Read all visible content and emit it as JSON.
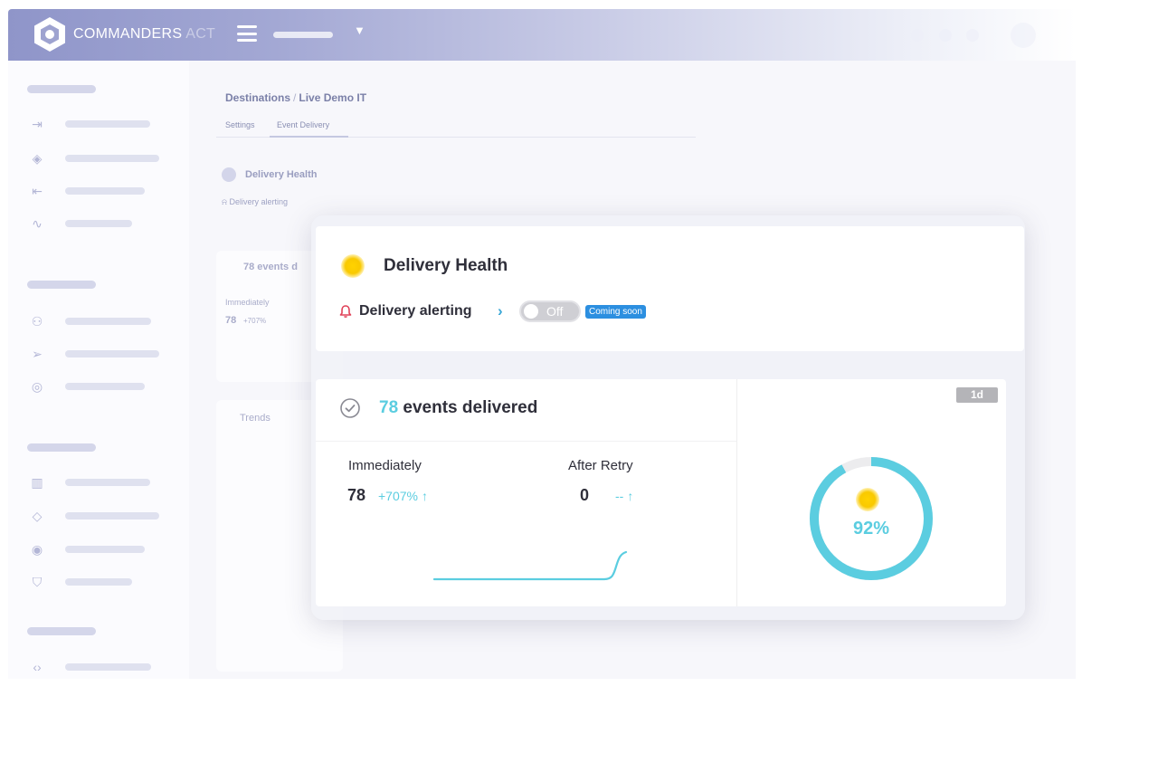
{
  "app": {
    "brand": "COMMANDERS",
    "brand_suffix": "ACT"
  },
  "breadcrumb": {
    "parent": "Destinations",
    "separator": "/",
    "current": "Live Demo IT"
  },
  "tabs": [
    {
      "label": "Settings",
      "active": false
    },
    {
      "label": "Event Delivery",
      "active": true
    }
  ],
  "background": {
    "delivery_health": "Delivery Health",
    "delivery_alerting": "Delivery alerting",
    "events": "78 events d",
    "immediately": "Immediately",
    "value": "78",
    "delta": "+707%",
    "trends": "Trends"
  },
  "health": {
    "title": "Delivery Health",
    "status_icon": "sun-icon",
    "alerting_label": "Delivery alerting",
    "toggle_label": "Off",
    "toggle_on": false,
    "coming_soon": "Coming soon"
  },
  "events": {
    "count": "78",
    "label": "events delivered",
    "period": "1d",
    "immediately": {
      "label": "Immediately",
      "value": "78",
      "delta": "+707%"
    },
    "after_retry": {
      "label": "After Retry",
      "value": "0",
      "delta": "--"
    },
    "success_rate": "92%",
    "success_fraction": 0.92
  },
  "colors": {
    "accent": "#5bcde0",
    "brand_purple": "#8f95c9",
    "alert_red": "#e0445a",
    "coming_soon_blue": "#2c8fe0"
  }
}
